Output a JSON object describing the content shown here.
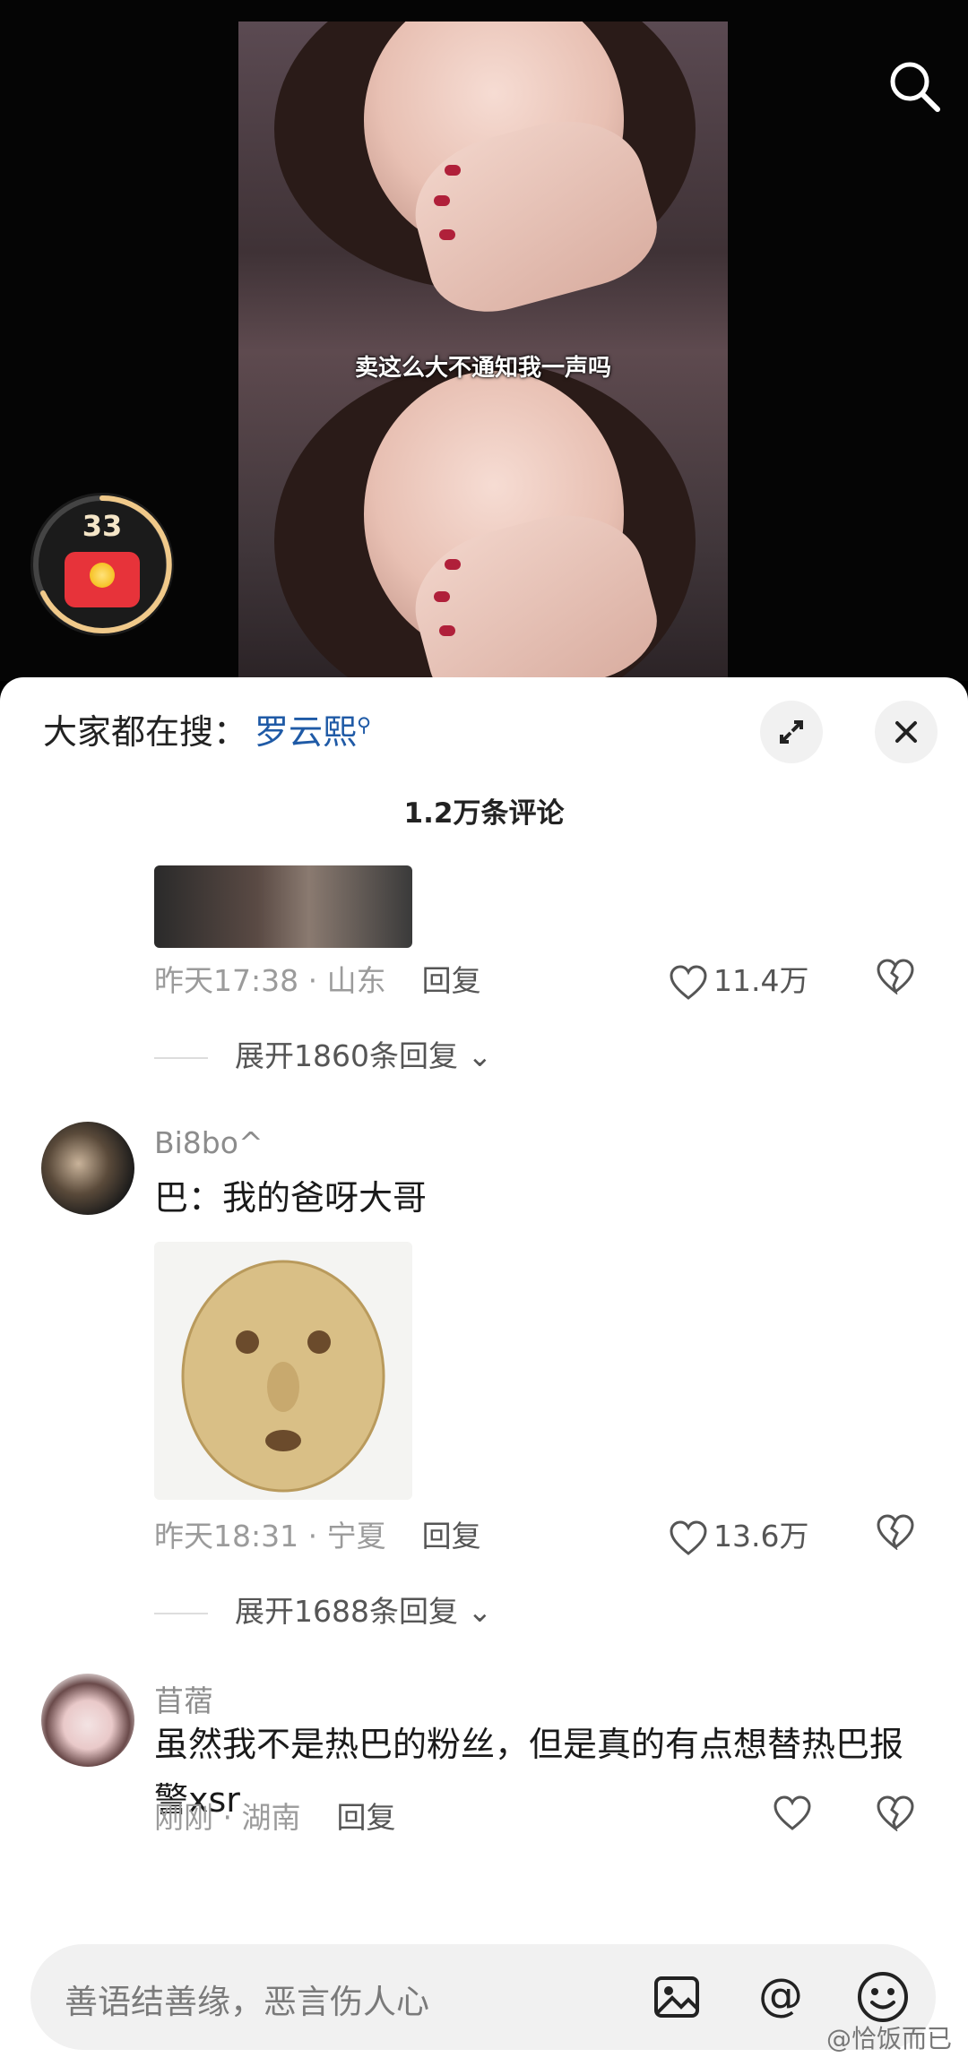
{
  "video": {
    "subtitle": "卖这么大不通知我一声吗",
    "reward_count": "33"
  },
  "sheet": {
    "hot_search_label": "大家都在搜：",
    "hot_search_keyword": "罗云熙",
    "comment_count": "1.2万条评论"
  },
  "comments": [
    {
      "time_location": "昨天17:38 · 山东",
      "reply_label": "回复",
      "likes": "11.4万",
      "expand_label": "展开1860条回复"
    },
    {
      "username": "Bi8bo^",
      "text": "巴：我的爸呀大哥",
      "time_location": "昨天18:31 · 宁夏",
      "reply_label": "回复",
      "likes": "13.6万",
      "expand_label": "展开1688条回复"
    },
    {
      "username": "苜蓿",
      "text": "虽然我不是热巴的粉丝，但是真的有点想替热巴报警xsr",
      "time_location": "刚刚 · 湖南",
      "reply_label": "回复",
      "likes": ""
    }
  ],
  "input": {
    "placeholder": "善语结善缘，恶言伤人心"
  },
  "watermark": "@恰饭而已",
  "colors": {
    "accent_link": "#1f5aa6",
    "reward_red": "#e7333a",
    "reward_ring": "#f0c98a"
  }
}
